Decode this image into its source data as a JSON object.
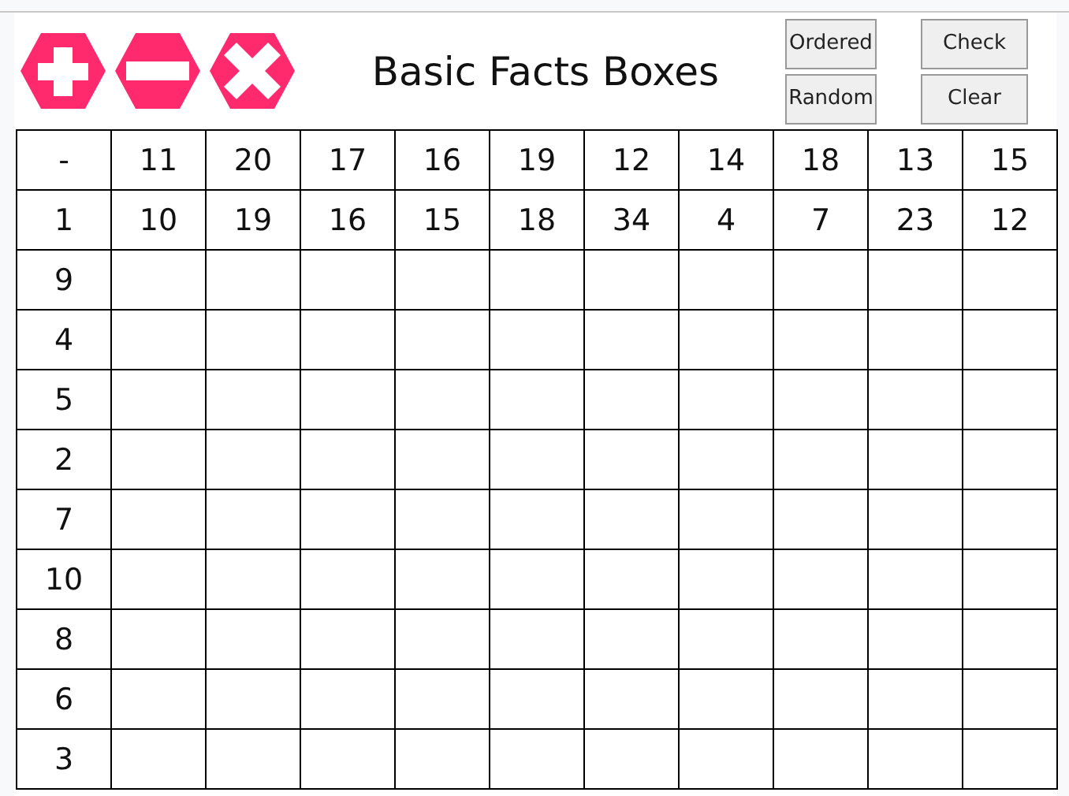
{
  "tools": [
    {
      "kind": "plus"
    },
    {
      "kind": "minus"
    },
    {
      "kind": "times"
    }
  ],
  "title": "Basic Facts Boxes",
  "buttons": [
    "Ordered",
    "Check",
    "Random",
    "Clear"
  ],
  "table": {
    "header_row": [
      "-",
      "11",
      "20",
      "17",
      "16",
      "19",
      "12",
      "14",
      "18",
      "13",
      "15"
    ],
    "answer_row": [
      "1",
      "10",
      "19",
      "16",
      "15",
      "18",
      "34",
      "4",
      "7",
      "23",
      "12"
    ],
    "rows": [
      {
        "label": "9"
      },
      {
        "label": "4"
      },
      {
        "label": "5"
      },
      {
        "label": "2"
      },
      {
        "label": "7"
      },
      {
        "label": "10"
      },
      {
        "label": "8"
      },
      {
        "label": "6"
      },
      {
        "label": "3"
      }
    ]
  }
}
